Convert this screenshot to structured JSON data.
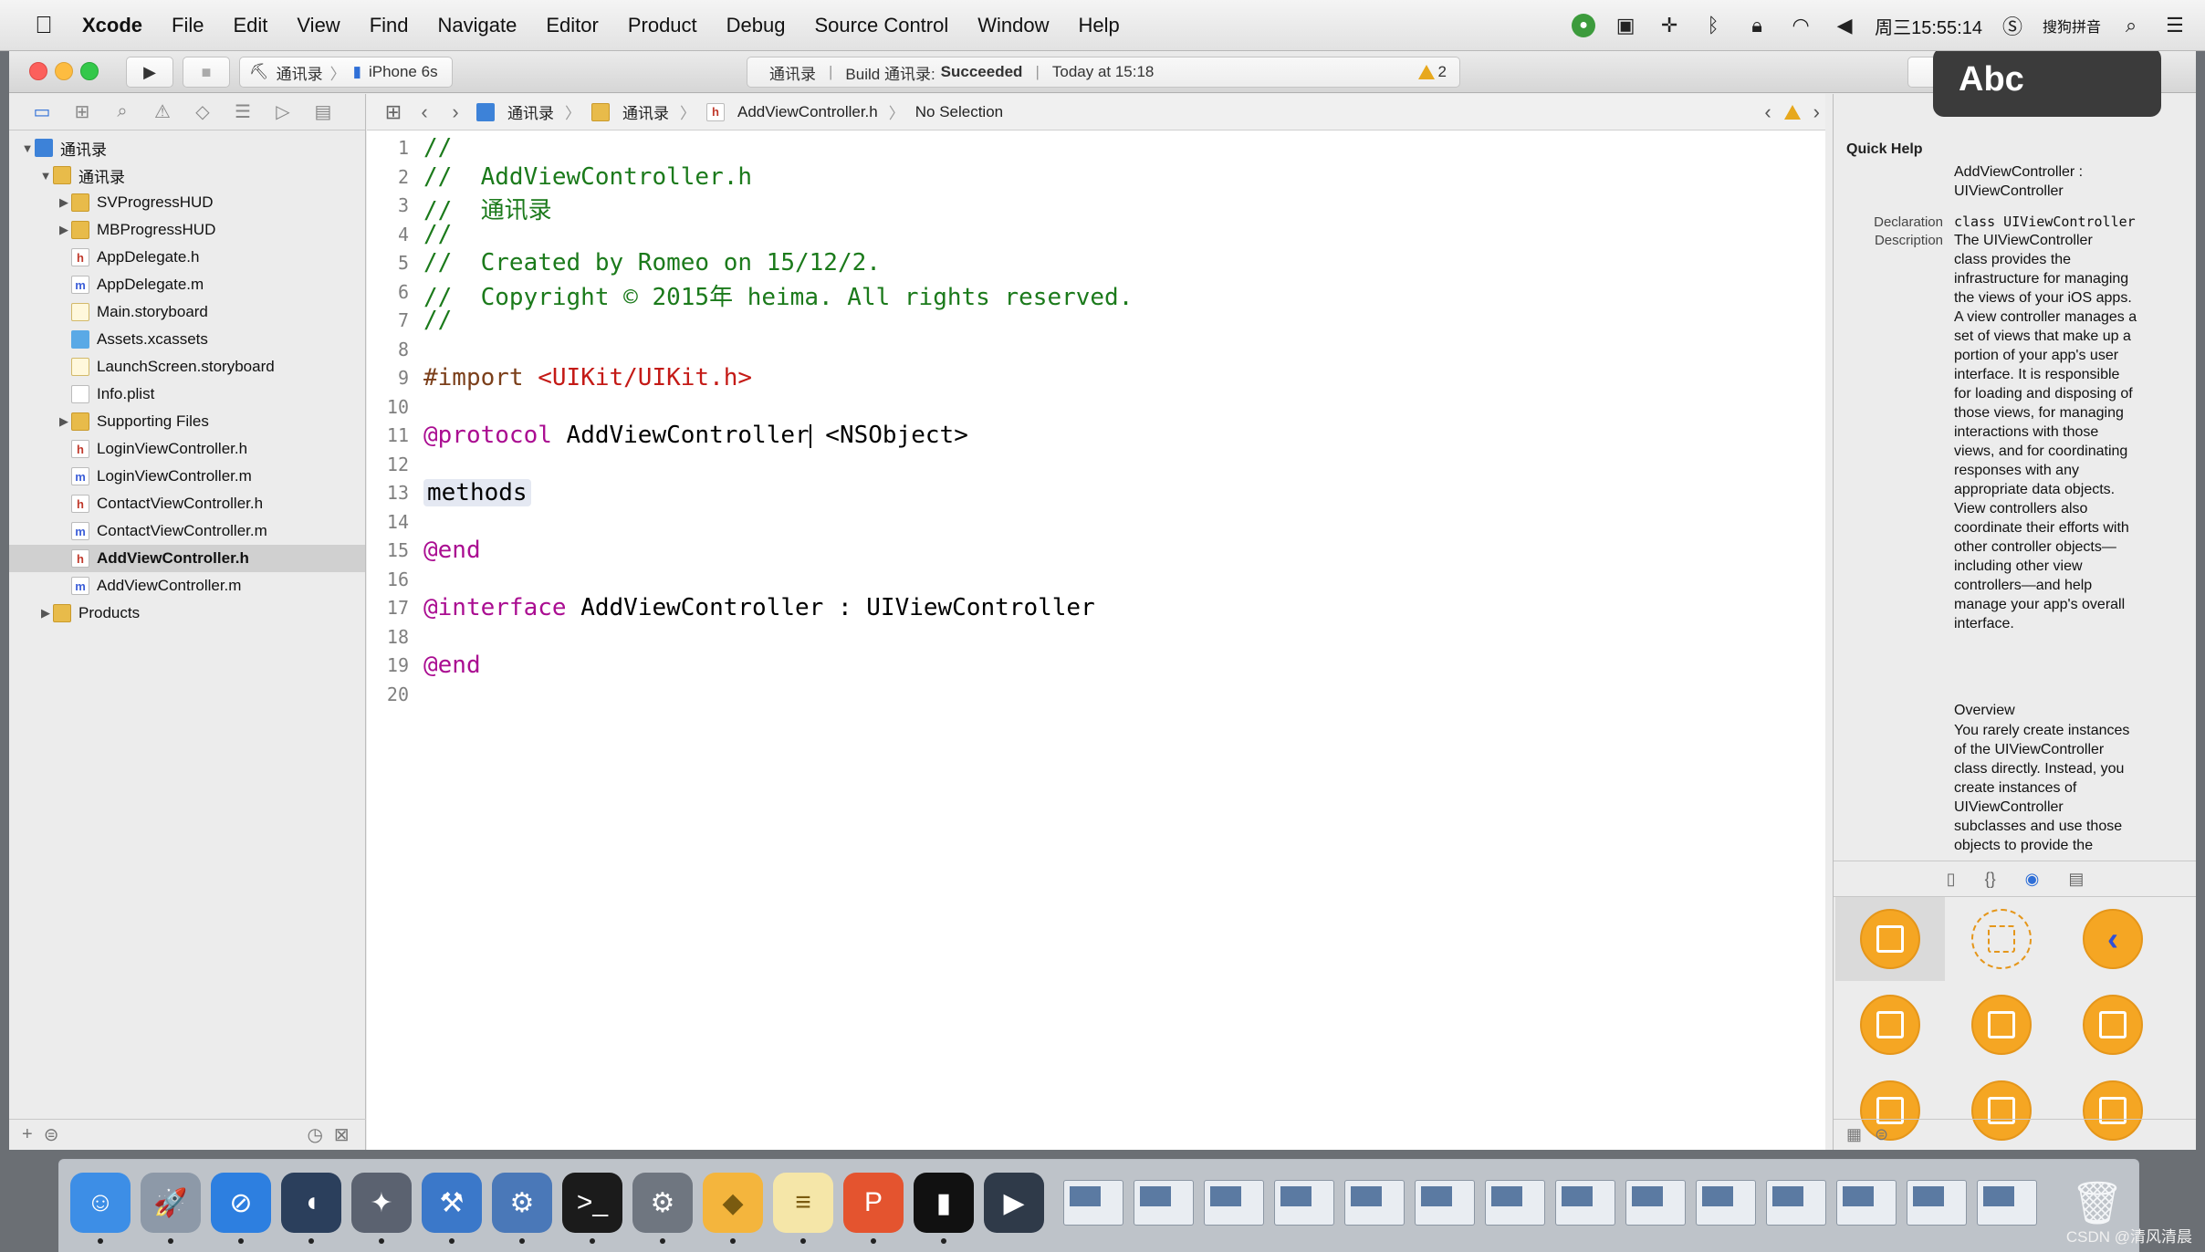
{
  "menubar": {
    "app": "Xcode",
    "items": [
      "File",
      "Edit",
      "View",
      "Find",
      "Navigate",
      "Editor",
      "Product",
      "Debug",
      "Source Control",
      "Window",
      "Help"
    ],
    "clock": "周三15:55:14",
    "ime": "搜狗拼音"
  },
  "toolbar": {
    "scheme": "通讯录",
    "device": "iPhone 6s",
    "status_project": "通讯录",
    "status_build": "Build 通讯录:",
    "status_result": "Succeeded",
    "status_time": "Today at 15:18",
    "warning_count": "2",
    "ime_popup": "Abc"
  },
  "navigator": {
    "items": [
      {
        "label": "通讯录",
        "type": "proj",
        "disclosure": "▼",
        "indent": 0
      },
      {
        "label": "通讯录",
        "type": "folder",
        "disclosure": "▼",
        "indent": 1
      },
      {
        "label": "SVProgressHUD",
        "type": "folder",
        "disclosure": "▶",
        "indent": 2
      },
      {
        "label": "MBProgressHUD",
        "type": "folder",
        "disclosure": "▶",
        "indent": 2
      },
      {
        "label": "AppDelegate.h",
        "type": "h",
        "disclosure": "",
        "indent": 2
      },
      {
        "label": "AppDelegate.m",
        "type": "m",
        "disclosure": "",
        "indent": 2
      },
      {
        "label": "Main.storyboard",
        "type": "sb",
        "disclosure": "",
        "indent": 2
      },
      {
        "label": "Assets.xcassets",
        "type": "xc",
        "disclosure": "",
        "indent": 2
      },
      {
        "label": "LaunchScreen.storyboard",
        "type": "sb",
        "disclosure": "",
        "indent": 2
      },
      {
        "label": "Info.plist",
        "type": "pl",
        "disclosure": "",
        "indent": 2
      },
      {
        "label": "Supporting Files",
        "type": "folder",
        "disclosure": "▶",
        "indent": 2
      },
      {
        "label": "LoginViewController.h",
        "type": "h",
        "disclosure": "",
        "indent": 2
      },
      {
        "label": "LoginViewController.m",
        "type": "m",
        "disclosure": "",
        "indent": 2
      },
      {
        "label": "ContactViewController.h",
        "type": "h",
        "disclosure": "",
        "indent": 2
      },
      {
        "label": "ContactViewController.m",
        "type": "m",
        "disclosure": "",
        "indent": 2
      },
      {
        "label": "AddViewController.h",
        "type": "h",
        "disclosure": "",
        "indent": 2,
        "selected": true
      },
      {
        "label": "AddViewController.m",
        "type": "m",
        "disclosure": "",
        "indent": 2
      },
      {
        "label": "Products",
        "type": "folder",
        "disclosure": "▶",
        "indent": 1
      }
    ]
  },
  "jumpbar": {
    "crumbs": [
      "通讯录",
      "通讯录",
      "AddViewController.h",
      "No Selection"
    ]
  },
  "editor": {
    "lines": [
      [
        {
          "t": "//",
          "c": "comment"
        }
      ],
      [
        {
          "t": "//  AddViewController.h",
          "c": "comment"
        }
      ],
      [
        {
          "t": "//  通讯录",
          "c": "comment"
        }
      ],
      [
        {
          "t": "//",
          "c": "comment"
        }
      ],
      [
        {
          "t": "//  Created by Romeo on 15/12/2.",
          "c": "comment"
        }
      ],
      [
        {
          "t": "//  Copyright © 2015年 heima. All rights reserved.",
          "c": "comment"
        }
      ],
      [
        {
          "t": "//",
          "c": "comment"
        }
      ],
      [],
      [
        {
          "t": "#import ",
          "c": "prep"
        },
        {
          "t": "<UIKit/UIKit.h>",
          "c": "str"
        }
      ],
      [],
      [
        {
          "t": "@protocol",
          "c": "kw"
        },
        {
          "t": " AddViewController",
          "c": "type"
        },
        {
          "t": "",
          "c": "caret"
        },
        {
          "t": " <NSObject>",
          "c": "type"
        }
      ],
      [],
      [
        {
          "t": "methods",
          "c": "ph"
        }
      ],
      [],
      [
        {
          "t": "@end",
          "c": "kw"
        }
      ],
      [],
      [
        {
          "t": "@interface",
          "c": "kw"
        },
        {
          "t": " AddViewController : UIViewController",
          "c": "type"
        }
      ],
      [],
      [
        {
          "t": "@end",
          "c": "kw"
        }
      ],
      []
    ]
  },
  "quickhelp": {
    "title": "Quick Help",
    "name_line1": "AddViewController :",
    "name_line2": "UIViewController",
    "declaration_label": "Declaration",
    "declaration": "class UIViewController",
    "description_label": "Description",
    "description_lines": [
      "The UIViewController",
      "class provides the",
      "infrastructure for managing",
      "the views of your iOS apps.",
      "A view controller manages a",
      "set of views that make up a",
      "portion of your app's user",
      "interface. It is responsible",
      "for loading and disposing of",
      "those views, for managing",
      "interactions with those",
      "views, and for coordinating",
      "responses with any",
      "appropriate data objects.",
      "View controllers also",
      "coordinate their efforts with",
      "other controller objects—",
      "including other view",
      "controllers—and help",
      "manage your app's overall",
      "interface."
    ],
    "overview_title": "Overview",
    "overview_lines": [
      "You rarely create instances",
      "of the UIViewController",
      "class directly. Instead, you",
      "create instances of",
      "UIViewController",
      "subclasses and use those",
      "objects to provide the"
    ]
  },
  "dock": {
    "apps": [
      {
        "name": "finder-icon",
        "color": "#3d8ee6",
        "glyph": "☺"
      },
      {
        "name": "launchpad-icon",
        "color": "#8d99a8",
        "glyph": "🚀"
      },
      {
        "name": "safari-icon",
        "color": "#2d7fe0",
        "glyph": "⊘"
      },
      {
        "name": "mouse-icon",
        "color": "#2b3f5c",
        "glyph": "◖"
      },
      {
        "name": "imovie-icon",
        "color": "#5b6270",
        "glyph": "✦"
      },
      {
        "name": "xcode-icon",
        "color": "#3b78c9",
        "glyph": "⚒"
      },
      {
        "name": "instruments-icon",
        "color": "#4a78b8",
        "glyph": "⚙"
      },
      {
        "name": "terminal-icon",
        "color": "#1b1b1b",
        "glyph": ">_"
      },
      {
        "name": "system-preferences-icon",
        "color": "#6f7680",
        "glyph": "⚙"
      },
      {
        "name": "sketch-icon",
        "color": "#f4b53d",
        "glyph": "◆"
      },
      {
        "name": "notes-icon",
        "color": "#f5e6a8",
        "glyph": "≡"
      },
      {
        "name": "presentation-icon",
        "color": "#e4542f",
        "glyph": "P"
      },
      {
        "name": "console-icon",
        "color": "#111111",
        "glyph": "▮"
      },
      {
        "name": "quicktime-icon",
        "color": "#2f3a49",
        "glyph": "▶"
      }
    ],
    "trash": "trash-icon",
    "watermark": "CSDN @清风清晨"
  }
}
